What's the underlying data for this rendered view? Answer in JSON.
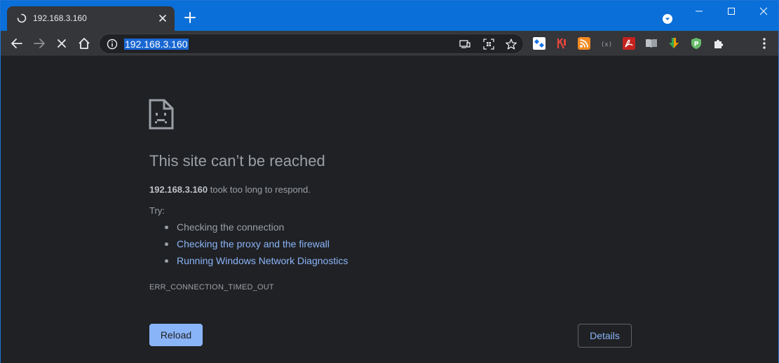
{
  "tab": {
    "title": "192.168.3.160",
    "loading_icon": "spinner-icon",
    "close_icon": "close-icon"
  },
  "window_controls": {
    "minimize_icon": "minimize-icon",
    "maximize_icon": "maximize-icon",
    "close_icon": "close-icon"
  },
  "omnibox": {
    "url": "192.168.3.160",
    "security_icon": "info-icon"
  },
  "extensions": [
    "extension-icon-1",
    "extension-icon-2",
    "rss-icon",
    "extension-icon-4",
    "pdf-icon",
    "reader-icon",
    "download-icon",
    "vpn-icon",
    "puzzle-icon"
  ],
  "error_page": {
    "heading": "This site can’t be reached",
    "host": "192.168.3.160",
    "summary_suffix": " took too long to respond.",
    "try_label": "Try:",
    "suggestions": [
      {
        "text": "Checking the connection",
        "link": false
      },
      {
        "text": "Checking the proxy and the firewall",
        "link": true
      },
      {
        "text": "Running Windows Network Diagnostics",
        "link": true
      }
    ],
    "error_code": "ERR_CONNECTION_TIMED_OUT",
    "reload_label": "Reload",
    "details_label": "Details"
  },
  "colors": {
    "titlebar": "#0a6fd8",
    "toolbar": "#35363a",
    "page_background": "#202124",
    "link": "#8ab4f8",
    "text_secondary": "#9aa0a6"
  }
}
